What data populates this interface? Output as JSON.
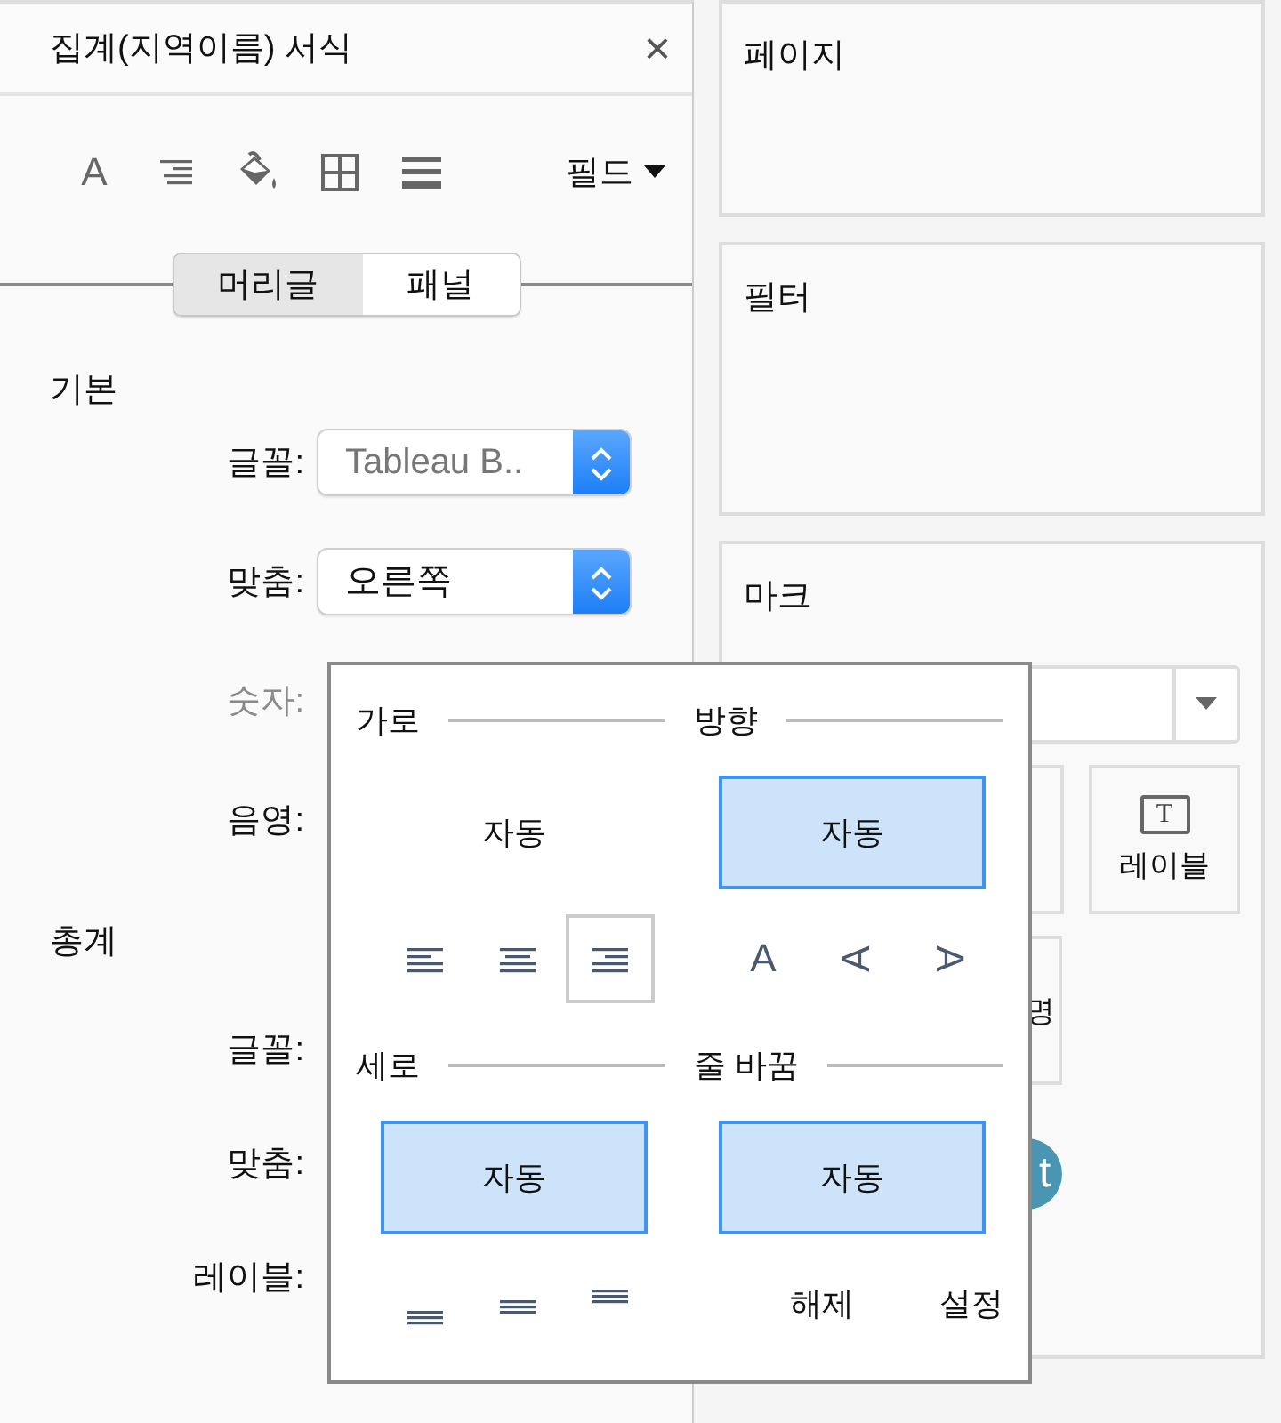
{
  "panel": {
    "title": "집계(지역이름) 서식",
    "close": "×",
    "toolbar": {
      "font_glyph": "A",
      "field_menu": "필드"
    },
    "tabs": [
      {
        "label": "머리글",
        "selected": true
      },
      {
        "label": "패널",
        "selected": false
      }
    ],
    "sections": [
      {
        "title": "기본",
        "rows": [
          {
            "label": "글꼴:",
            "disabled": false,
            "value": "Tableau B..",
            "value_muted": true
          },
          {
            "label": "맞춤:",
            "disabled": false,
            "value": "오른쪽",
            "value_muted": false
          },
          {
            "label": "숫자:",
            "disabled": true
          },
          {
            "label": "음영:",
            "disabled": false
          }
        ]
      },
      {
        "title": "총계",
        "rows": [
          {
            "label": "글꼴:",
            "disabled": false
          },
          {
            "label": "맞춤:",
            "disabled": false
          },
          {
            "label": "레이블:",
            "disabled": false
          }
        ]
      }
    ]
  },
  "right": {
    "cards": [
      {
        "title": "페이지"
      },
      {
        "title": "필터"
      }
    ],
    "marks": {
      "title": "마크",
      "label_button": {
        "glyph": "T",
        "label": "레이블"
      },
      "partial_button_text": "명",
      "pill_text": "t"
    }
  },
  "popup": {
    "groups": [
      {
        "title": "가로",
        "option": {
          "label": "자동",
          "selected": false
        },
        "choices": [
          {
            "kind": "align-left",
            "selected": false
          },
          {
            "kind": "align-center",
            "selected": false
          },
          {
            "kind": "align-right",
            "selected": true
          }
        ]
      },
      {
        "title": "방향",
        "option": {
          "label": "자동",
          "selected": true
        },
        "choices": [
          {
            "kind": "rotate-none",
            "label": "A",
            "selected": false
          },
          {
            "kind": "rotate-left",
            "label": "A",
            "selected": false
          },
          {
            "kind": "rotate-right",
            "label": "A",
            "selected": false
          }
        ]
      },
      {
        "title": "세로",
        "option": {
          "label": "자동",
          "selected": true
        },
        "choices": [
          {
            "kind": "valign-bottom",
            "selected": false
          },
          {
            "kind": "valign-middle",
            "selected": false
          },
          {
            "kind": "valign-top",
            "selected": false
          }
        ]
      },
      {
        "title": "줄 바꿈",
        "option": {
          "label": "자동",
          "selected": true
        },
        "choices": [
          {
            "kind": "text",
            "label": "해제",
            "selected": false
          },
          {
            "kind": "text",
            "label": "설정",
            "selected": false
          }
        ]
      }
    ]
  }
}
